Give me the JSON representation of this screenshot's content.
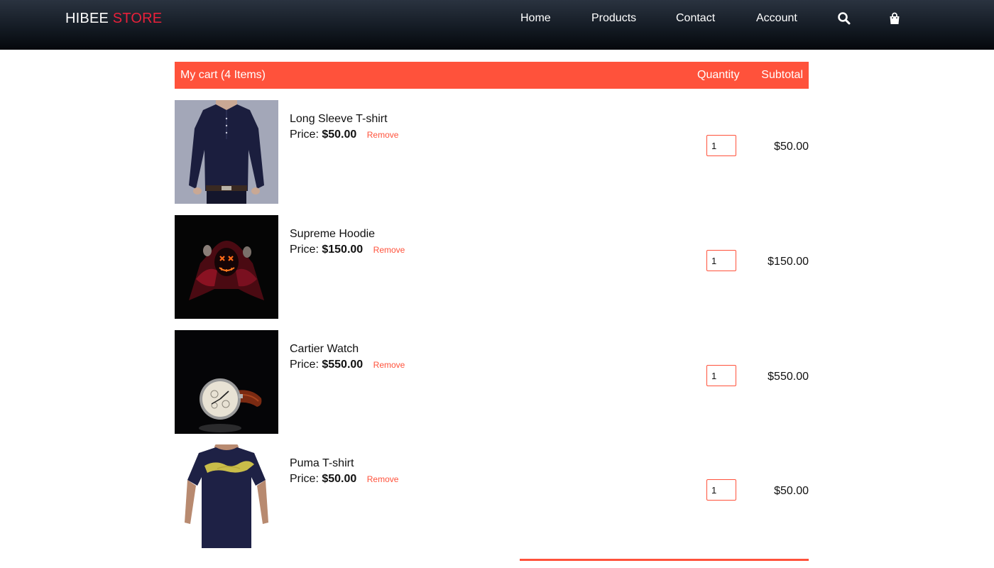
{
  "nav": {
    "brand_main": "HIBEE",
    "brand_accent": "STORE",
    "links": [
      "Home",
      "Products",
      "Contact",
      "Account"
    ],
    "search_icon": "search-icon",
    "bag_icon": "shopping-bag-icon"
  },
  "cart": {
    "title": "My cart (4 Items)",
    "qty_header": "Quantity",
    "subtotal_header": "Subtotal",
    "price_label": "Price:",
    "remove_label": "Remove",
    "items": [
      {
        "name": "Long Sleeve T-shirt",
        "price": "$50.00",
        "qty": "1",
        "subtotal": "$50.00"
      },
      {
        "name": "Supreme Hoodie",
        "price": "$150.00",
        "qty": "1",
        "subtotal": "$150.00"
      },
      {
        "name": "Cartier Watch",
        "price": "$550.00",
        "qty": "1",
        "subtotal": "$550.00"
      },
      {
        "name": "Puma T-shirt",
        "price": "$50.00",
        "qty": "1",
        "subtotal": "$50.00"
      }
    ]
  },
  "colors": {
    "accent": "#ff523b",
    "brand_accent": "#e8203a",
    "nav_bg": "#141b24"
  }
}
